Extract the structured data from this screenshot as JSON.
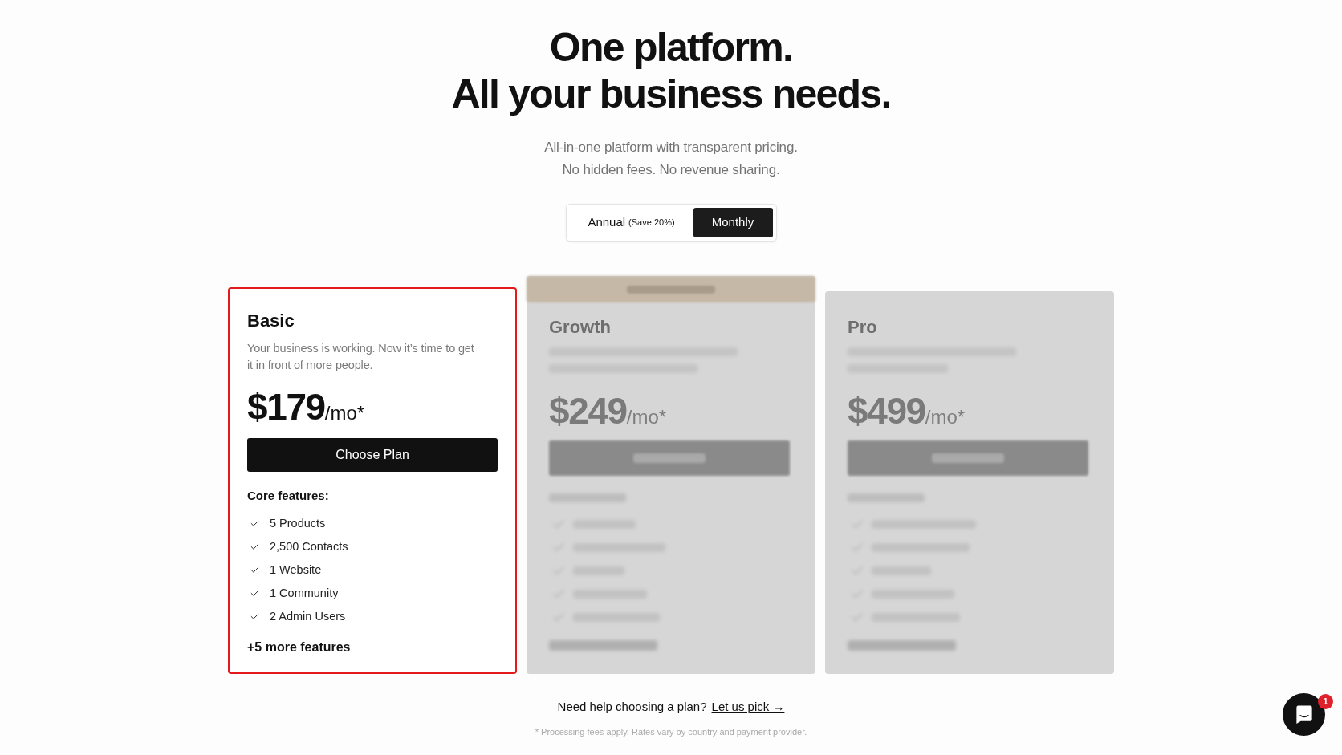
{
  "headline": [
    "One platform.",
    "All your business needs."
  ],
  "subtitle": [
    "All-in-one platform with transparent pricing.",
    "No hidden fees. No revenue sharing."
  ],
  "billing_toggle": [
    {
      "label": "Annual",
      "note": "(Save 20%)",
      "selected": false
    },
    {
      "label": "Monthly",
      "selected": true
    }
  ],
  "plans": [
    {
      "kind": "open",
      "highlighted": true,
      "name": "Basic",
      "description": "Your business is working. Now it’s time to get it in front of more people.",
      "price": "$179",
      "period": "/mo*",
      "button": "Choose Plan",
      "features_heading": "Core features:",
      "features": [
        "5 Products",
        "2,500 Contacts",
        "1 Website",
        "1 Community",
        "2 Admin Users"
      ],
      "more_features": "+5 more features"
    },
    {
      "kind": "blurred",
      "top_banner": true,
      "name": "Growth",
      "price": "$249",
      "period": "/mo*"
    },
    {
      "kind": "blurred",
      "top_banner": false,
      "name": "Pro",
      "price": "$499",
      "period": "/mo*"
    }
  ],
  "help": {
    "text": "Need help choosing a plan?",
    "link": "Let us pick →"
  },
  "footnote": "* Processing fees apply. Rates vary by country and payment provider.",
  "chat": {
    "badge": "1"
  }
}
